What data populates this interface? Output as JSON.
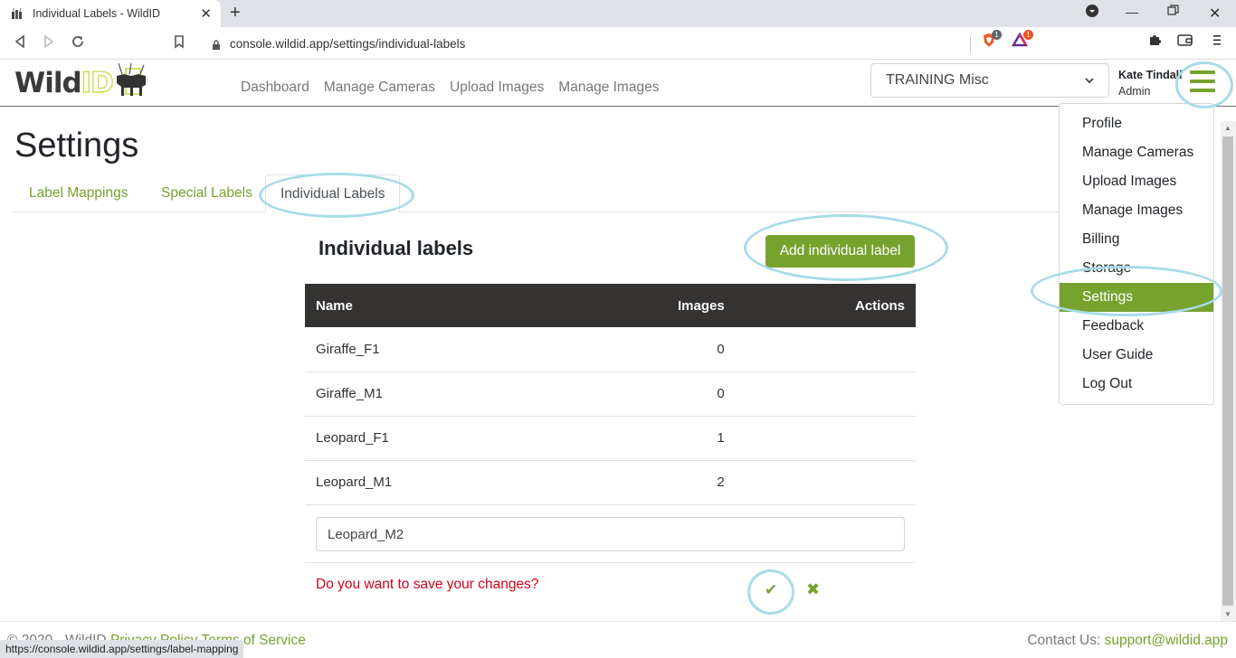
{
  "browser": {
    "tab_title": "Individual Labels - WildID",
    "url": "console.wildid.app/settings/individual-labels",
    "status_url": "https://console.wildid.app/settings/label-mapping",
    "extensions": [
      {
        "name": "brave-shield",
        "badge": "1"
      },
      {
        "name": "brave-rewards",
        "badge": "1"
      }
    ]
  },
  "header": {
    "logo_wild": "Wild",
    "logo_id": "ID",
    "nav": [
      "Dashboard",
      "Manage Cameras",
      "Upload Images",
      "Manage Images"
    ],
    "project_selected": "TRAINING Misc",
    "user_name": "Kate Tindall",
    "user_role": "Admin"
  },
  "page": {
    "title": "Settings",
    "tabs": [
      {
        "label": "Label Mappings",
        "active": false
      },
      {
        "label": "Special Labels",
        "active": false
      },
      {
        "label": "Individual Labels",
        "active": true
      }
    ],
    "section_title": "Individual labels",
    "add_button": "Add individual label",
    "table": {
      "columns": [
        "Name",
        "Images",
        "Actions"
      ],
      "rows": [
        {
          "name": "Giraffe_F1",
          "images": "0"
        },
        {
          "name": "Giraffe_M1",
          "images": "0"
        },
        {
          "name": "Leopard_F1",
          "images": "1"
        },
        {
          "name": "Leopard_M1",
          "images": "2"
        }
      ]
    },
    "new_label_value": "Leopard_M2",
    "confirm_text": "Do you want to save your changes?",
    "confirm_icon": "check-icon",
    "cancel_icon": "x-icon"
  },
  "dropdown": {
    "items": [
      "Profile",
      "Manage Cameras",
      "Upload Images",
      "Manage Images",
      "Billing",
      "Storage",
      "Settings",
      "Feedback",
      "User Guide",
      "Log Out"
    ],
    "active": "Settings"
  },
  "footer": {
    "copyright": "© 2020 - WildID",
    "privacy": "Privacy Policy",
    "terms": "Terms of Service",
    "contact_label": "Contact Us:",
    "contact_email": "support@wildid.app"
  },
  "colors": {
    "brand_green": "#76a22e",
    "table_header": "#353232",
    "warning_red": "#d0021b",
    "annotation_ring": "#a8dbe8"
  }
}
